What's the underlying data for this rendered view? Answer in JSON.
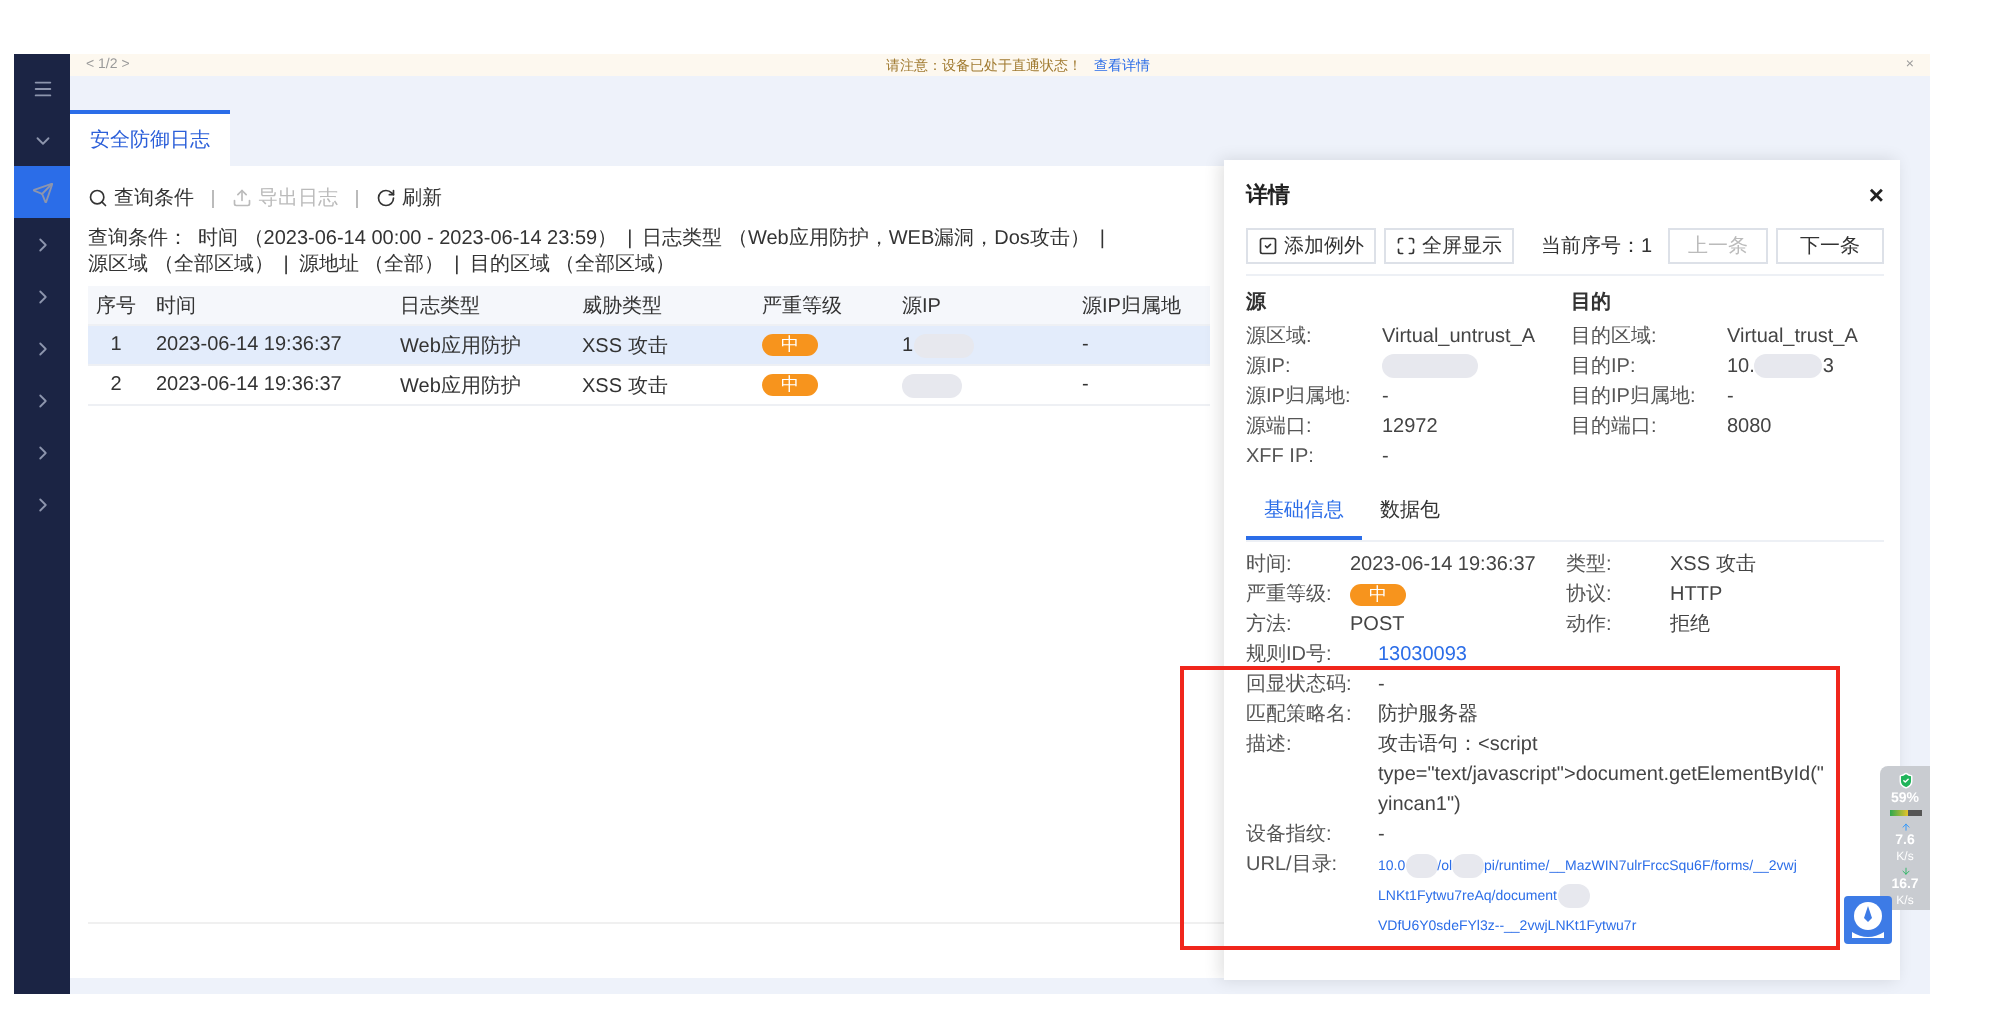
{
  "notice": {
    "pager": "< 1/2 >",
    "message": "请注意：设备已处于直通状态！",
    "link": "查看详情",
    "close": "×"
  },
  "sidebar": {
    "items": [
      {
        "kind": "menu",
        "selected": false
      },
      {
        "kind": "collapse",
        "selected": false
      },
      {
        "kind": "item",
        "selected": true
      },
      {
        "kind": "group",
        "selected": false
      },
      {
        "kind": "group",
        "selected": false
      },
      {
        "kind": "group",
        "selected": false
      },
      {
        "kind": "group",
        "selected": false
      },
      {
        "kind": "group",
        "selected": false
      },
      {
        "kind": "group",
        "selected": false
      }
    ]
  },
  "tabs": [
    {
      "label": "安全防御日志",
      "selected": true
    }
  ],
  "toolbar": [
    {
      "kind": "search",
      "label": "查询条件",
      "disabled": false
    },
    {
      "kind": "export",
      "label": "导出日志",
      "disabled": true
    },
    {
      "kind": "refresh",
      "label": "刷新",
      "disabled": false
    }
  ],
  "query": {
    "label": "查询条件：",
    "separator": "|",
    "segments": [
      "时间 （2023-06-14 00:00 - 2023-06-14 23:59）",
      "日志类型 （Web应用防护，WEB漏洞，Dos攻击）",
      "源区域 （全部区域）",
      "源地址 （全部）",
      "目的区域 （全部区域）"
    ]
  },
  "table": {
    "columns": [
      "序号",
      "时间",
      "日志类型",
      "威胁类型",
      "严重等级",
      "源IP",
      "源IP归属地"
    ],
    "rows": [
      {
        "index": "1",
        "time": "2023-06-14 19:36:37",
        "log_type": "Web应用防护",
        "threat_type": "XSS 攻击",
        "severity": "中",
        "source_ip": "1",
        "source_location": "-",
        "selected": true
      },
      {
        "index": "2",
        "time": "2023-06-14 19:36:37",
        "log_type": "Web应用防护",
        "threat_type": "XSS 攻击",
        "severity": "中",
        "source_location": "-",
        "selected": false
      }
    ]
  },
  "detail": {
    "title": "详情",
    "close": "×",
    "actions": [
      {
        "kind": "exception",
        "label": "添加例外"
      },
      {
        "kind": "fullscreen",
        "label": "全屏显示"
      }
    ],
    "current_label": "当前序号：",
    "current_value": "1",
    "prev": {
      "label": "上一条",
      "disabled": true
    },
    "next": {
      "label": "下一条",
      "disabled": false
    },
    "source": {
      "heading": "源",
      "fields": [
        {
          "label": "源区域:",
          "value": "Virtual_untrust_A"
        },
        {
          "label": "源IP:",
          "blurred": true
        },
        {
          "label": "源IP归属地:",
          "value": "-"
        },
        {
          "label": "源端口:",
          "value": "12972"
        },
        {
          "label": "XFF IP:",
          "value": "-"
        }
      ]
    },
    "destination": {
      "heading": "目的",
      "fields": [
        {
          "label": "目的区域:",
          "value": "Virtual_trust_A"
        },
        {
          "label": "目的IP:",
          "value": "10.",
          "blurred": true,
          "suffix": "3"
        },
        {
          "label": "目的IP归属地:",
          "value": "-"
        },
        {
          "label": "目的端口:",
          "value": "8080"
        }
      ]
    },
    "tabs": [
      {
        "label": "基础信息",
        "selected": true
      },
      {
        "label": "数据包",
        "selected": false
      }
    ],
    "pairs": [
      [
        {
          "label": "时间:",
          "value": "2023-06-14 19:36:37",
          "kind": "text"
        },
        {
          "label": "类型:",
          "value": "XSS 攻击",
          "kind": "text"
        }
      ],
      [
        {
          "label": "严重等级:",
          "value": "中",
          "kind": "badge"
        },
        {
          "label": "协议:",
          "value": "HTTP",
          "kind": "text"
        }
      ],
      [
        {
          "label": "方法:",
          "value": "POST",
          "kind": "text"
        },
        {
          "label": "动作:",
          "value": "拒绝",
          "kind": "text"
        }
      ]
    ],
    "rows": [
      {
        "label": "规则ID号:",
        "value": "13030093",
        "kind": "link"
      },
      {
        "label": "回显状态码:",
        "value": "-",
        "kind": "text"
      },
      {
        "label": "匹配策略名:",
        "value": "防护服务器",
        "kind": "text"
      },
      {
        "label": "描述:",
        "value": "攻击语句：<script type=\"text/javascript\">document.getElementById(\"yincan1\")",
        "kind": "text"
      },
      {
        "label": "设备指纹:",
        "value": "-",
        "kind": "text"
      },
      {
        "label": "URL/目录:",
        "kind": "url",
        "lines": [
          [
            "10.0",
            "/ol",
            "pi/runtime/__MazWIN7ulrFrccSqu6F/forms/__2vwj"
          ],
          [
            "LNKt1Fytwu7reAq/document",
            "VDfU6Y0sdeFYl3z--__2vwjLNKt1Fytwu7r"
          ]
        ]
      }
    ]
  },
  "monitor": {
    "percent": "59%",
    "level": 0.59,
    "up": "7.6",
    "up_unit": "K/s",
    "down": "16.7",
    "down_unit": "K/s"
  }
}
